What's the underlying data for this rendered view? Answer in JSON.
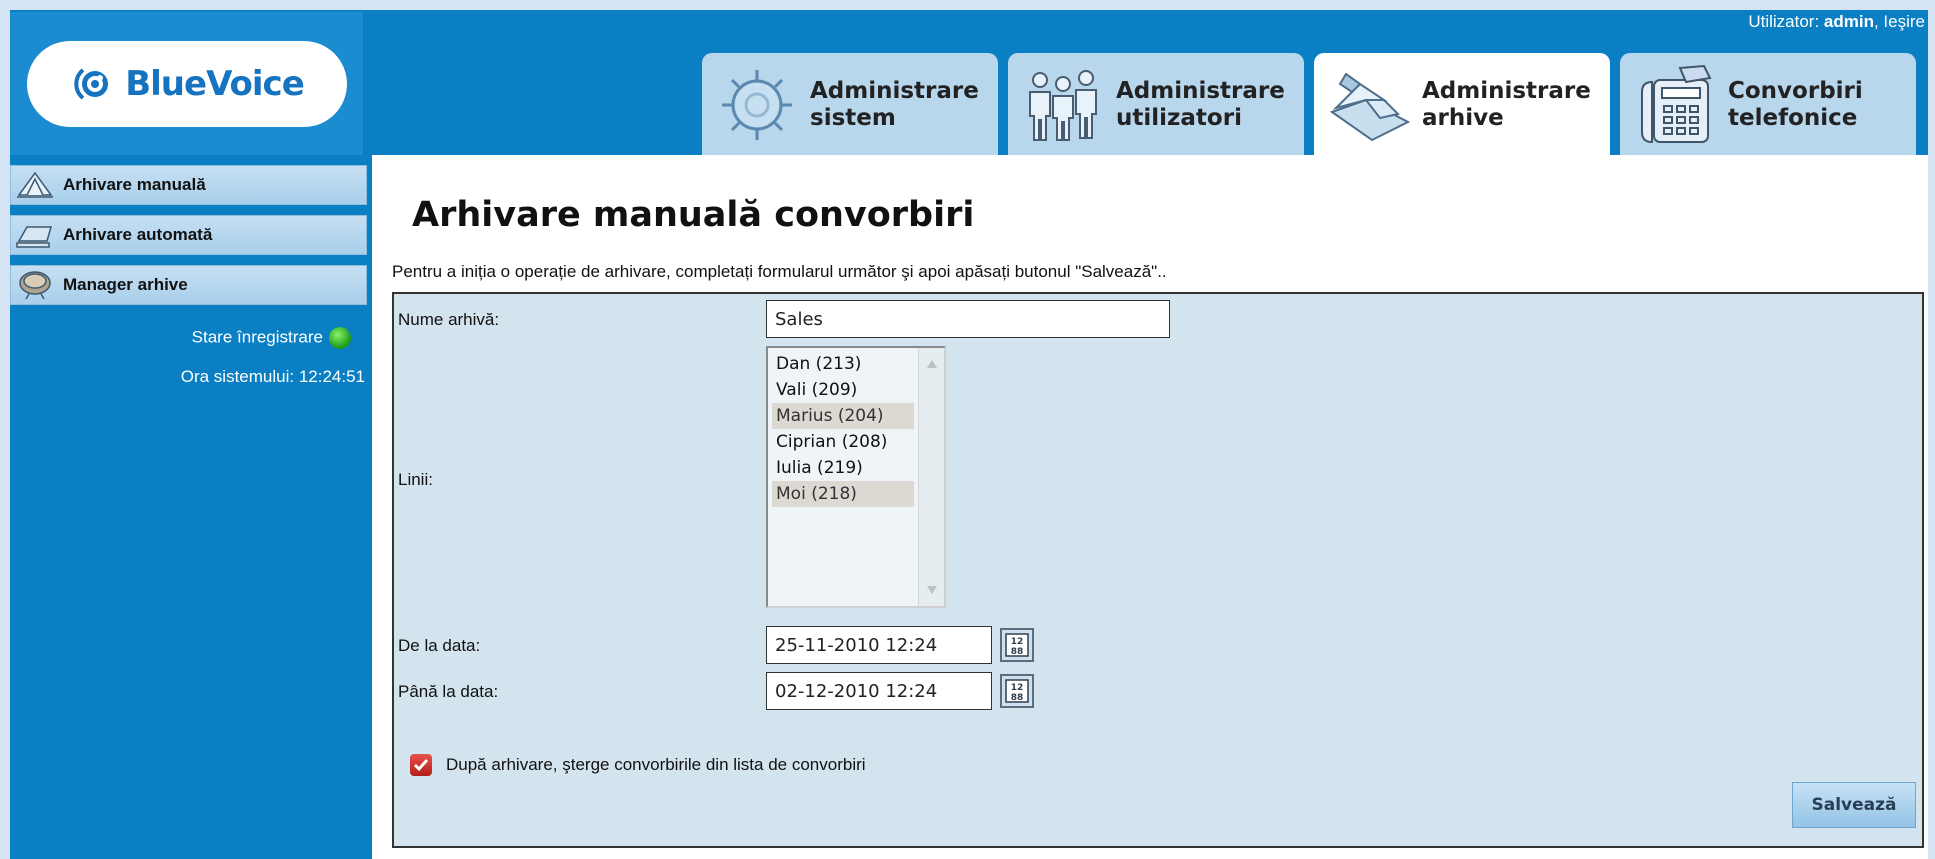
{
  "header": {
    "user_prefix": "Utilizator: ",
    "user_name": "admin",
    "separator": ", ",
    "logout": "Ieşire"
  },
  "logo": {
    "text": "BlueVoice",
    "brand_color": "#1573bf"
  },
  "tabs": [
    {
      "label": "Administrare\nsistem",
      "icon": "gear-icon",
      "active": false
    },
    {
      "label": "Administrare\nutilizatori",
      "icon": "users-icon",
      "active": false
    },
    {
      "label": "Administrare\narhive",
      "icon": "archive-icon",
      "active": true
    },
    {
      "label": "Convorbiri\ntelefonice",
      "icon": "phone-icon",
      "active": false
    }
  ],
  "sidebar": {
    "items": [
      {
        "label": "Arhivare manuală",
        "icon": "manual-archive-icon"
      },
      {
        "label": "Arhivare automată",
        "icon": "auto-archive-icon"
      },
      {
        "label": "Manager arhive",
        "icon": "archive-manager-icon"
      }
    ],
    "recording_status": "Stare înregistrare",
    "recording_status_color": "#1b9a12",
    "system_time": "Ora sistemului: 12:24:51"
  },
  "main": {
    "title": "Arhivare manuală convorbiri",
    "intro": "Pentru a iniția o operație de arhivare, completați formularul următor şi apoi apăsați butonul \"Salvează\"..",
    "form": {
      "archive_name_label": "Nume arhivă:",
      "archive_name_value": "Sales",
      "lines_label": "Linii:",
      "lines": [
        {
          "label": "Dan (213)",
          "selected": false
        },
        {
          "label": "Vali (209)",
          "selected": false
        },
        {
          "label": "Marius (204)",
          "selected": true
        },
        {
          "label": "Ciprian (208)",
          "selected": false
        },
        {
          "label": "Iulia (219)",
          "selected": false
        },
        {
          "label": "Moi (218)",
          "selected": true
        }
      ],
      "from_label": "De la data:",
      "from_value": "25-11-2010 12:24",
      "to_label": "Până la data:",
      "to_value": "02-12-2010 12:24",
      "delete_after_label": "După arhivare, şterge convorbirile din lista de convorbiri",
      "delete_after_checked": true,
      "save_label": "Salvează"
    }
  }
}
